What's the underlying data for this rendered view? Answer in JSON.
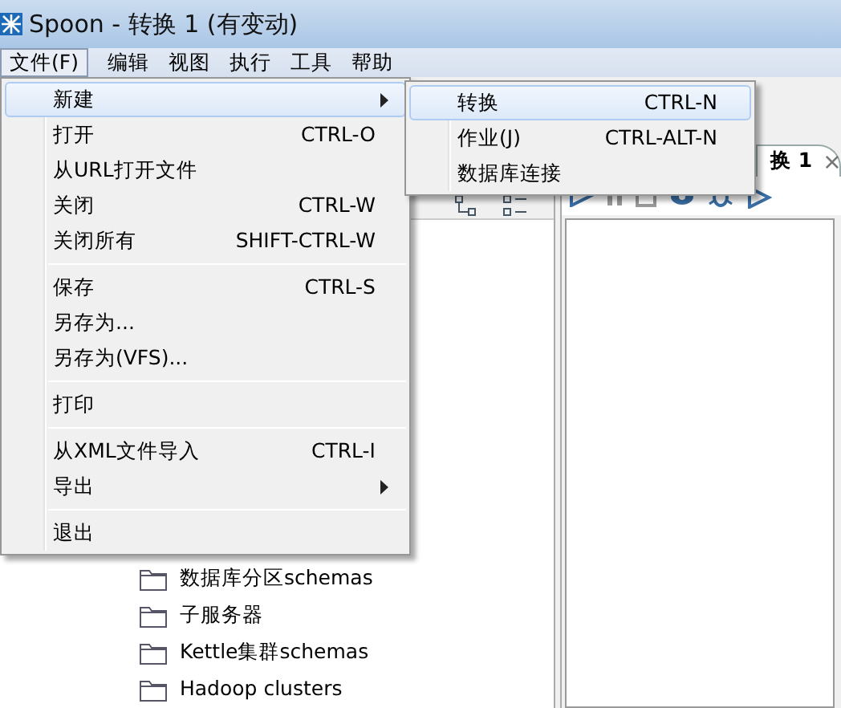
{
  "window": {
    "title": "Spoon - 转换 1 (有变动)"
  },
  "menu_bar": [
    {
      "label": "文件(F)",
      "selected": true
    },
    {
      "label": "编辑",
      "selected": false
    },
    {
      "label": "视图",
      "selected": false
    },
    {
      "label": "执行",
      "selected": false
    },
    {
      "label": "工具",
      "selected": false
    },
    {
      "label": "帮助",
      "selected": false
    }
  ],
  "file_menu": [
    {
      "kind": "item",
      "label": "新建",
      "submenu": true,
      "selected": true
    },
    {
      "kind": "item",
      "label": "打开",
      "shortcut": "CTRL-O",
      "selected": false
    },
    {
      "kind": "item",
      "label": "从URL打开文件",
      "selected": false
    },
    {
      "kind": "item",
      "label": "关闭",
      "shortcut": "CTRL-W",
      "selected": false
    },
    {
      "kind": "item",
      "label": "关闭所有",
      "shortcut": "SHIFT-CTRL-W",
      "selected": false
    },
    {
      "kind": "separator"
    },
    {
      "kind": "item",
      "label": "保存",
      "shortcut": "CTRL-S",
      "selected": false
    },
    {
      "kind": "item",
      "label": "另存为...",
      "selected": false
    },
    {
      "kind": "item",
      "label": "另存为(VFS)...",
      "selected": false
    },
    {
      "kind": "separator"
    },
    {
      "kind": "item",
      "label": "打印",
      "selected": false
    },
    {
      "kind": "separator"
    },
    {
      "kind": "item",
      "label": "从XML文件导入",
      "shortcut": "CTRL-I",
      "selected": false
    },
    {
      "kind": "item",
      "label": "导出",
      "submenu": true,
      "selected": false
    },
    {
      "kind": "separator"
    },
    {
      "kind": "item",
      "label": "退出",
      "selected": false
    }
  ],
  "new_submenu": [
    {
      "label": "转换",
      "shortcut": "CTRL-N",
      "selected": true
    },
    {
      "label": "作业(J)",
      "shortcut": "CTRL-ALT-N",
      "selected": false
    },
    {
      "label": "数据库连接",
      "selected": false
    }
  ],
  "editor_tab": {
    "label": "换 1"
  },
  "tree": [
    {
      "label": "数据库分区schemas"
    },
    {
      "label": "子服务器"
    },
    {
      "label": "Kettle集群schemas"
    },
    {
      "label": "Hadoop clusters"
    }
  ]
}
